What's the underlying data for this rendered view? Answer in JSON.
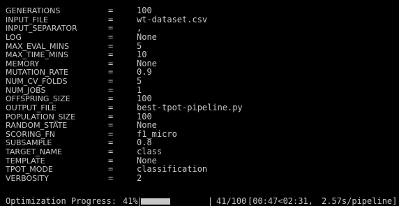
{
  "config_rows": [
    {
      "key": "GENERATIONS",
      "eq": "=",
      "value": "100"
    },
    {
      "key": "INPUT_FILE",
      "eq": "=",
      "value": "wt-dataset.csv"
    },
    {
      "key": "INPUT_SEPARATOR",
      "eq": "=",
      "value": ","
    },
    {
      "key": "LOG",
      "eq": "=",
      "value": "None"
    },
    {
      "key": "MAX_EVAL_MINS",
      "eq": "=",
      "value": "5"
    },
    {
      "key": "MAX_TIME_MINS",
      "eq": "=",
      "value": "10"
    },
    {
      "key": "MEMORY",
      "eq": "=",
      "value": "None"
    },
    {
      "key": "MUTATION_RATE",
      "eq": "=",
      "value": "0.9"
    },
    {
      "key": "NUM_CV_FOLDS",
      "eq": "=",
      "value": "5"
    },
    {
      "key": "NUM_JOBS",
      "eq": "=",
      "value": "1"
    },
    {
      "key": "OFFSPRING_SIZE",
      "eq": "=",
      "value": "100"
    },
    {
      "key": "OUTPUT_FILE",
      "eq": "=",
      "value": "best-tpot-pipeline.py"
    },
    {
      "key": "POPULATION_SIZE",
      "eq": "=",
      "value": "100"
    },
    {
      "key": "RANDOM_STATE",
      "eq": "=",
      "value": "None"
    },
    {
      "key": "SCORING_FN",
      "eq": "=",
      "value": "f1_micro"
    },
    {
      "key": "SUBSAMPLE",
      "eq": "=",
      "value": "0.8"
    },
    {
      "key": "TARGET_NAME",
      "eq": "=",
      "value": "class"
    },
    {
      "key": "TEMPLATE",
      "eq": "=",
      "value": "None"
    },
    {
      "key": "TPOT_MODE",
      "eq": "=",
      "value": "classification"
    },
    {
      "key": "VERBOSITY",
      "eq": "=",
      "value": "2"
    }
  ],
  "progress": {
    "label": "Optimization Progress:",
    "percent_text": "41%",
    "fraction": 0.41,
    "left_sep": "|",
    "right_sep": "|",
    "count_text": "41/100",
    "time_text": "[00:47<02:31,",
    "rate_text": "2.57s/pipeline]"
  },
  "colors": {
    "background": "#000000",
    "text": "#c8c8c8"
  }
}
